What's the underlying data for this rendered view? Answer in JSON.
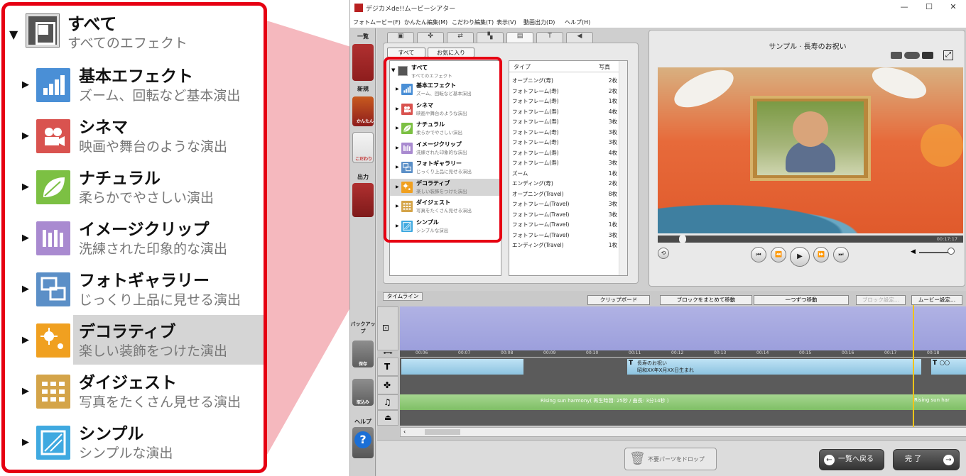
{
  "zoom": {
    "root": {
      "title": "すべて",
      "subtitle": "すべてのエフェクト"
    },
    "items": [
      {
        "title": "基本エフェクト",
        "subtitle": "ズーム、回転など基本演出",
        "icon": "grid-chart-icon",
        "color": "#4a8fd6"
      },
      {
        "title": "シネマ",
        "subtitle": "映画や舞台のような演出",
        "icon": "movie-camera-icon",
        "color": "#d9534f"
      },
      {
        "title": "ナチュラル",
        "subtitle": "柔らかでやさしい演出",
        "icon": "leaf-icon",
        "color": "#7cc043"
      },
      {
        "title": "イメージクリップ",
        "subtitle": "洗練された印象的な演出",
        "icon": "image-clip-icon",
        "color": "#a98ad0"
      },
      {
        "title": "フォトギャラリー",
        "subtitle": "じっくり上品に見せる演出",
        "icon": "gallery-icon",
        "color": "#5b8fc7"
      },
      {
        "title": "デコラティブ",
        "subtitle": "楽しい装飾をつけた演出",
        "icon": "sparkle-icon",
        "color": "#f0a020"
      },
      {
        "title": "ダイジェスト",
        "subtitle": "写真をたくさん見せる演出",
        "icon": "digest-grid-icon",
        "color": "#d4a449"
      },
      {
        "title": "シンプル",
        "subtitle": "シンプルな演出",
        "icon": "simple-frame-icon",
        "color": "#3fa9e0"
      }
    ]
  },
  "app": {
    "title": "デジカメde!!ムービーシアター",
    "menu": [
      "フォトムービー(F)",
      "かんたん編集(M)",
      "こだわり編集(T)",
      "表示(V)",
      "動画出力(D)",
      "ヘルプ(H)"
    ],
    "left_tools": {
      "top_label": "一覧",
      "new_label": "新規",
      "easy_label": "かんたん",
      "custom_label": "こだわり",
      "output_label": "出力",
      "backup_label": "バックアップ",
      "save_label": "保存",
      "import_label": "取込み",
      "help_label": "ヘルプ"
    },
    "subtabs": [
      "すべて",
      "お気に入り"
    ],
    "list": {
      "header_type": "タイプ",
      "header_count": "写真",
      "rows": [
        {
          "name": "オープニング(寿)",
          "count": "2枚"
        },
        {
          "name": "フォトフレーム(寿)",
          "count": "2枚"
        },
        {
          "name": "フォトフレーム(寿)",
          "count": "1枚"
        },
        {
          "name": "フォトフレーム(寿)",
          "count": "4枚"
        },
        {
          "name": "フォトフレーム(寿)",
          "count": "3枚"
        },
        {
          "name": "フォトフレーム(寿)",
          "count": "3枚"
        },
        {
          "name": "フォトフレーム(寿)",
          "count": "3枚"
        },
        {
          "name": "フォトフレーム(寿)",
          "count": "4枚"
        },
        {
          "name": "フォトフレーム(寿)",
          "count": "3枚"
        },
        {
          "name": "ズーム",
          "count": "1枚"
        },
        {
          "name": "エンディング(寿)",
          "count": "2枚"
        },
        {
          "name": "オープニング(Travel)",
          "count": "8枚"
        },
        {
          "name": "フォトフレーム(Travel)",
          "count": "3枚"
        },
        {
          "name": "フォトフレーム(Travel)",
          "count": "3枚"
        },
        {
          "name": "フォトフレーム(Travel)",
          "count": "1枚"
        },
        {
          "name": "フォトフレーム(Travel)",
          "count": "3枚"
        },
        {
          "name": "エンディング(Travel)",
          "count": "1枚"
        }
      ]
    },
    "preview": {
      "title": "サンプル · 長寿のお祝い",
      "time": "00:17:17"
    },
    "timeline": {
      "tab": "タイムライン",
      "buttons": [
        "クリップボード",
        "ブロックをまとめて移動",
        "一つずつ移動",
        "ブロック設定...",
        "ムービー設定..."
      ],
      "ruler": [
        "00:06",
        "00:07",
        "00:08",
        "00:09",
        "00:10",
        "00:11",
        "00:12",
        "00:13",
        "00:14",
        "00:15",
        "00:16",
        "00:17",
        "00:18"
      ],
      "text_clip_1": "長寿のお祝い",
      "text_clip_2": "昭和XX年X月XX日生まれ",
      "text_clip_end": "〇〇",
      "music_clip": "Rising sun harmony( 再生時間: 25秒 / 曲長: 3分14秒 )",
      "music_clip_end": "Rising sun har"
    },
    "bottom": {
      "drop_label": "不要パーツをドロップ",
      "back_label": "一覧へ戻る",
      "done_label": "完 了"
    }
  }
}
